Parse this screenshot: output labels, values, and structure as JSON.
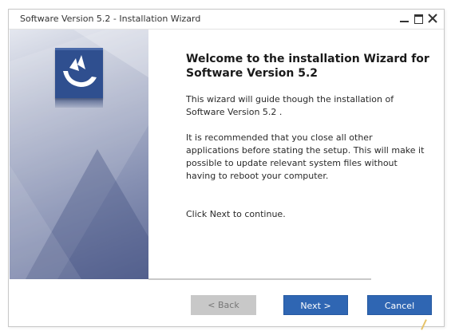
{
  "window": {
    "title": "Software Version 5.2 - Installation Wizard"
  },
  "content": {
    "heading": "Welcome to the installation Wizard for Software Version 5.2",
    "paragraph1": "This wizard will guide though the installation of Software Version 5.2 .",
    "paragraph2": "It is recommended that you close all other applications before stating the setup. This will make it possible to update relevant system files without having to reboot your computer.",
    "paragraph3": "Click Next to continue."
  },
  "buttons": {
    "back_label": "< Back",
    "next_label": "Next >",
    "cancel_label": "Cancel"
  },
  "icons": {
    "minimize": "minimize-icon",
    "maximize": "maximize-icon",
    "close": "close-icon",
    "logo": "installer-logo-icon"
  },
  "colors": {
    "primary_button": "#2f66b3",
    "disabled_button": "#c8c8c8",
    "logo_bg": "#2f4f8f",
    "banner_dark": "#5e6a96"
  },
  "states": {
    "back_enabled": false
  }
}
